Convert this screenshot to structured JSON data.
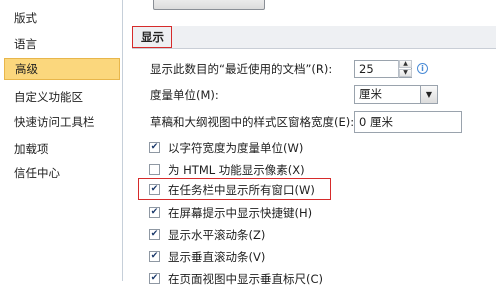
{
  "sidebar": {
    "items": [
      {
        "label": "版式"
      },
      {
        "label": "语言"
      },
      {
        "label": "高级",
        "selected": true
      },
      {
        "label": "自定义功能区"
      },
      {
        "label": "快速访问工具栏"
      },
      {
        "label": "加载项"
      },
      {
        "label": "信任中心"
      }
    ]
  },
  "display": {
    "section_title": "显示",
    "recent_docs": {
      "label": "显示此数目的“最近使用的文档”(R):",
      "value": "25"
    },
    "units": {
      "label": "度量单位(M):",
      "value": "厘米"
    },
    "style_width": {
      "label": "草稿和大纲视图中的样式区窗格宽度(E):",
      "value": "0 厘米"
    },
    "checkboxes": [
      {
        "label": "以字符宽度为度量单位(W)",
        "checked": true
      },
      {
        "label": "为 HTML 功能显示像素(X)",
        "checked": false
      },
      {
        "label": "在任务栏中显示所有窗口(W)",
        "checked": true,
        "highlighted": true
      },
      {
        "label": "在屏幕提示中显示快捷键(H)",
        "checked": true
      },
      {
        "label": "显示水平滚动条(Z)",
        "checked": true
      },
      {
        "label": "显示垂直滚动条(V)",
        "checked": true
      },
      {
        "label": "在页面视图中显示垂直标尺(C)",
        "checked": true
      }
    ]
  },
  "icons": {
    "check": "✔",
    "spin_up": "▲",
    "spin_down": "▼",
    "dropdown": "▼",
    "info": "i"
  },
  "colors": {
    "selected_bg": "#fbd77d",
    "highlight_border": "#d62b2b",
    "checkmark": "#1b3a6b"
  }
}
